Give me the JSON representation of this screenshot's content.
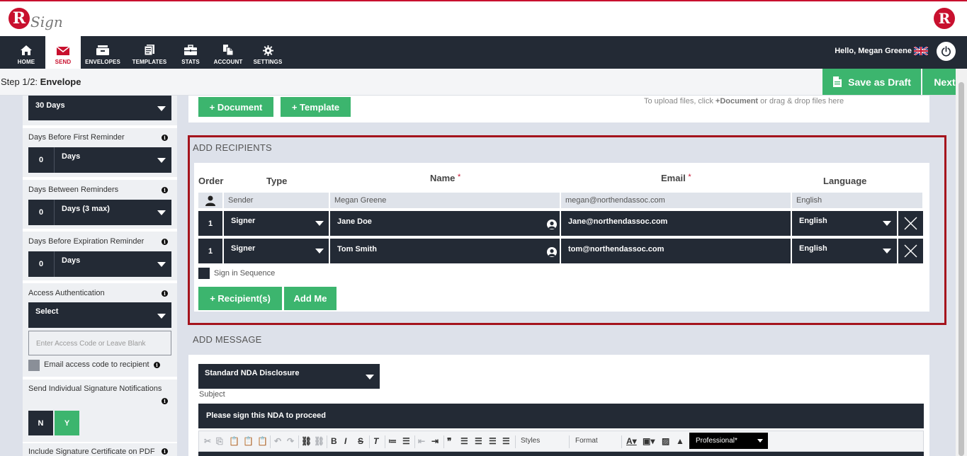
{
  "app": {
    "logo_letter": "R",
    "logo_script": "Sign"
  },
  "nav": {
    "items": [
      {
        "label": "HOME",
        "icon": "home-icon"
      },
      {
        "label": "SEND",
        "icon": "envelope-icon",
        "active": true
      },
      {
        "label": "ENVELOPES",
        "icon": "inbox-icon"
      },
      {
        "label": "TEMPLATES",
        "icon": "templates-icon"
      },
      {
        "label": "STATS",
        "icon": "briefcase-icon"
      },
      {
        "label": "ACCOUNT",
        "icon": "account-icon"
      },
      {
        "label": "SETTINGS",
        "icon": "gear-icon"
      }
    ],
    "greeting": "Hello, Megan Greene"
  },
  "step": {
    "prefix": "Step 1/2:",
    "title": "Envelope"
  },
  "actions": {
    "save_draft": "Save as Draft",
    "next": "Next"
  },
  "sidebar": {
    "expiry_value": "30 Days",
    "first_reminder": {
      "label": "Days Before First Reminder",
      "number": "0",
      "unit": "Days"
    },
    "between_reminders": {
      "label": "Days Between Reminders",
      "number": "0",
      "unit": "Days (3 max)"
    },
    "expiration_reminder": {
      "label": "Days Before Expiration Reminder",
      "number": "0",
      "unit": "Days"
    },
    "access_auth": {
      "label": "Access Authentication",
      "value": "Select",
      "placeholder": "Enter Access Code or Leave Blank",
      "email_label": "Email access code to recipient"
    },
    "individual_notifications": {
      "label": "Send Individual Signature Notifications",
      "no": "N",
      "yes": "Y"
    },
    "certificate": {
      "label": "Include Signature Certificate on PDF"
    }
  },
  "documents": {
    "add_document": "+ Document",
    "add_template": "+ Template",
    "hint_pre": "To upload files, click ",
    "hint_bold": "+Document",
    "hint_post": " or drag & drop files here"
  },
  "recipients": {
    "section_title": "ADD RECIPIENTS",
    "headers": {
      "order": "Order",
      "type": "Type",
      "name": "Name",
      "email": "Email",
      "language": "Language",
      "required": "*"
    },
    "sender": {
      "type": "Sender",
      "name": "Megan Greene",
      "email": "megan@northendassoc.com",
      "language": "English"
    },
    "rows": [
      {
        "order": "1",
        "type": "Signer",
        "name": "Jane Doe",
        "email": "Jane@northendassoc.com",
        "language": "English"
      },
      {
        "order": "1",
        "type": "Signer",
        "name": "Tom Smith",
        "email": "tom@northendassoc.com",
        "language": "English"
      }
    ],
    "sequence_label": "Sign in Sequence",
    "add_recipient": "+ Recipient(s)",
    "add_me": "Add Me"
  },
  "message": {
    "section_title": "ADD MESSAGE",
    "template_value": "Standard NDA Disclosure",
    "subject_label": "Subject",
    "subject_value": "Please sign this NDA to proceed",
    "toolbar": {
      "styles": "Styles",
      "format": "Format",
      "font_select": "Professional*"
    }
  },
  "colors": {
    "brand_red": "#c8102e",
    "nav_dark": "#232a35",
    "accent_green": "#3cb56e",
    "highlight_border": "#a5141d"
  }
}
